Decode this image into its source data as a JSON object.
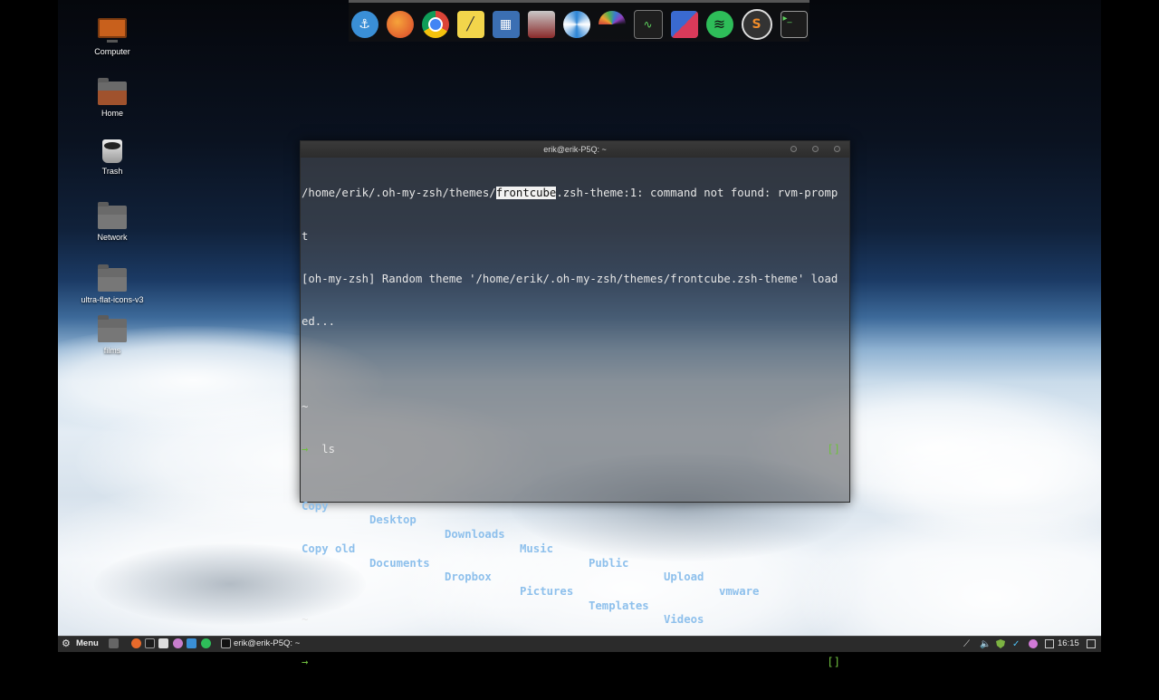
{
  "desktop": {
    "icons": [
      {
        "label": "Computer"
      },
      {
        "label": "Home"
      },
      {
        "label": "Trash"
      },
      {
        "label": "Network"
      },
      {
        "label": "ultra-flat-icons-v3"
      },
      {
        "label": "films"
      }
    ]
  },
  "dock": {
    "apps": [
      {
        "icon": "anchor-icon",
        "color": "#3a8fd6"
      },
      {
        "icon": "firefox-icon",
        "color": "#e86a2b"
      },
      {
        "icon": "chrome-icon",
        "color": "#3c9c3c"
      },
      {
        "icon": "notes-icon",
        "color": "#f2d54b"
      },
      {
        "icon": "video-editor-icon",
        "color": "#3b6fb3"
      },
      {
        "icon": "archive-manager-icon",
        "color": "#8a2a2a"
      },
      {
        "icon": "pinwheel-icon",
        "color": "#2c84d4"
      },
      {
        "icon": "rainbow-icon",
        "color": "#d04a3a"
      },
      {
        "icon": "system-monitor-icon",
        "color": "#1e1e1e"
      },
      {
        "icon": "cards-icon",
        "color": "#d83a5a"
      },
      {
        "icon": "spotify-icon",
        "color": "#2ebd59"
      },
      {
        "icon": "sublime-icon",
        "color": "#333333",
        "text": "S"
      },
      {
        "icon": "terminal-icon",
        "color": "#1c1c1c"
      }
    ]
  },
  "terminal": {
    "title": "erik@erik-P5Q: ~",
    "line1_pre": "/home/erik/.oh-my-zsh/themes/",
    "line1_hl": "frontcube",
    "line1_post": ".zsh-theme:1: command not found: rvm-promp",
    "line2": "t",
    "line3": "[oh-my-zsh] Random theme '/home/erik/.oh-my-zsh/themes/frontcube.zsh-theme' load",
    "line4": "ed...",
    "tilde": "~",
    "arrow": "→",
    "command": "ls",
    "bracket": "[]",
    "ls_output": {
      "row1": [
        "Copy",
        "Desktop",
        "Downloads",
        "Music",
        "Public",
        "Upload",
        "vmware"
      ],
      "row2": [
        "Copy old",
        "Documents",
        "Dropbox",
        "Pictures",
        "Templates",
        "Videos"
      ]
    }
  },
  "taskbar": {
    "menu_label": "Menu",
    "window_label": "erik@erik-P5Q: ~",
    "clock": "16:15"
  }
}
